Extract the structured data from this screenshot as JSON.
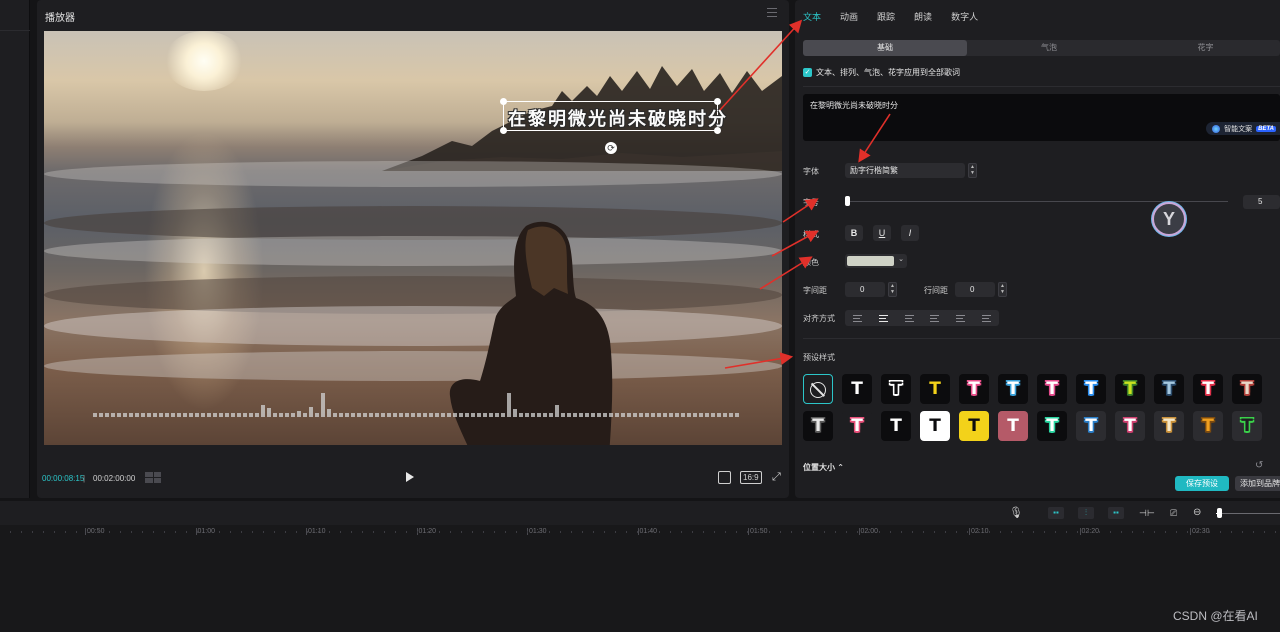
{
  "player": {
    "title": "播放器",
    "overlay_text": "在黎明微光尚未破晓时分",
    "current_time": "00:00:08:15",
    "separator": "|",
    "total_time": "00:02:00:00",
    "ratio_label": "16:9",
    "audio_levels": [
      4,
      4,
      4,
      4,
      4,
      4,
      4,
      4,
      4,
      4,
      4,
      4,
      4,
      4,
      4,
      4,
      4,
      4,
      4,
      4,
      4,
      4,
      4,
      4,
      4,
      4,
      4,
      4,
      12,
      9,
      4,
      4,
      4,
      4,
      6,
      4,
      10,
      4,
      24,
      8,
      4,
      4,
      4,
      4,
      4,
      4,
      4,
      4,
      4,
      4,
      4,
      4,
      4,
      4,
      4,
      4,
      4,
      4,
      4,
      4,
      4,
      4,
      4,
      4,
      4,
      4,
      4,
      4,
      4,
      24,
      8,
      4,
      4,
      4,
      4,
      4,
      4,
      12,
      4,
      4,
      4,
      4,
      4,
      4,
      4,
      4,
      4,
      4,
      4,
      4,
      4,
      4,
      4,
      4,
      4,
      4,
      4,
      4,
      4,
      4,
      4,
      4,
      4,
      4,
      4,
      4,
      4,
      4
    ]
  },
  "tabs": [
    {
      "label": "文本",
      "active": true
    },
    {
      "label": "动画",
      "active": false
    },
    {
      "label": "跟踪",
      "active": false
    },
    {
      "label": "朗读",
      "active": false
    },
    {
      "label": "数字人",
      "active": false
    }
  ],
  "subtabs": [
    "基础",
    "气泡",
    "花字"
  ],
  "apply_all_label": "文本、排列、气泡、花字应用到全部歌词",
  "text_content": "在黎明微光尚未破晓时分",
  "ai_button": {
    "label": "智能文案",
    "badge": "BETA"
  },
  "labels": {
    "font": "字体",
    "size": "字号",
    "style": "样式",
    "color": "颜色",
    "char_spacing": "字间距",
    "line_spacing": "行间距",
    "align": "对齐方式",
    "presets": "预设样式",
    "position_size": "位置大小"
  },
  "font_value": "励字行楷简繁",
  "size_value": "5",
  "style_buttons": [
    "B",
    "U",
    "I"
  ],
  "color_value": "#cfd2c6",
  "char_spacing_value": "0",
  "line_spacing_value": "0",
  "buttons": {
    "save_preset": "保存预设",
    "add_to_brand": "添加到品牌"
  },
  "presets": [
    {
      "glyph": "",
      "bg": "#1e1e21",
      "fg": "#e6e6e6",
      "stroke": "",
      "selected": true,
      "kind": "none"
    },
    {
      "glyph": "T",
      "bg": "#0c0c0e",
      "fg": "#ffffff",
      "stroke": ""
    },
    {
      "glyph": "T",
      "bg": "#0c0c0e",
      "fg": "#0c0c0e",
      "stroke": "#ffffff"
    },
    {
      "glyph": "T",
      "bg": "#0c0c0e",
      "fg": "#f3d21a",
      "stroke": ""
    },
    {
      "glyph": "T",
      "bg": "#0c0c0e",
      "fg": "#ffffff",
      "stroke": "#e8508a"
    },
    {
      "glyph": "T",
      "bg": "#0c0c0e",
      "fg": "#ffffff",
      "stroke": "#3aa0d8"
    },
    {
      "glyph": "T",
      "bg": "#0c0c0e",
      "fg": "#ffffff",
      "stroke": "#e44a8c"
    },
    {
      "glyph": "T",
      "bg": "#0c0c0e",
      "fg": "#ffffff",
      "stroke": "#2a8ef0"
    },
    {
      "glyph": "T",
      "bg": "#0c0c0e",
      "fg": "#c8e21f",
      "stroke": "#3a7d2a"
    },
    {
      "glyph": "T",
      "bg": "#0c0c0e",
      "fg": "#a5c8e0",
      "stroke": "#2a4a6a"
    },
    {
      "glyph": "T",
      "bg": "#0c0c0e",
      "fg": "#ffffff",
      "stroke": "#e0304a"
    },
    {
      "glyph": "T",
      "bg": "#0c0c0e",
      "fg": "#e8d8c8",
      "stroke": "#b0403a"
    },
    {
      "glyph": "T",
      "bg": "#0c0c0e",
      "fg": "#e8e8e8",
      "stroke": "#5a5a5a"
    },
    {
      "glyph": "T",
      "bg": "#1e1e21",
      "fg": "#ffffff",
      "stroke": "#e8507a"
    },
    {
      "glyph": "T",
      "bg": "#0c0c0e",
      "fg": "#ffffff",
      "stroke": ""
    },
    {
      "glyph": "T",
      "bg": "#ffffff",
      "fg": "#0c0c0e",
      "stroke": ""
    },
    {
      "glyph": "T",
      "bg": "#f3d21a",
      "fg": "#0c0c0e",
      "stroke": ""
    },
    {
      "glyph": "T",
      "bg": "#b55a68",
      "fg": "#ffffff",
      "stroke": ""
    },
    {
      "glyph": "T",
      "bg": "#0c0c0e",
      "fg": "#ffffff",
      "stroke": "#2ad4a0"
    },
    {
      "glyph": "T",
      "bg": "#2c2c30",
      "fg": "#ffffff",
      "stroke": "#2a7ec8"
    },
    {
      "glyph": "T",
      "bg": "#2c2c30",
      "fg": "#ffffff",
      "stroke": "#d04070"
    },
    {
      "glyph": "T",
      "bg": "#2c2c30",
      "fg": "#f6e8c8",
      "stroke": "#c8903a"
    },
    {
      "glyph": "T",
      "bg": "#2c2c30",
      "fg": "#f0a020",
      "stroke": "#7a4a10"
    },
    {
      "glyph": "T",
      "bg": "#2c2c30",
      "fg": "#1e1e21",
      "stroke": "#3ad04a"
    }
  ],
  "timeline": {
    "ticks": [
      "|00:50",
      "|01:00",
      "|01:10",
      "|01:20",
      "|01:30",
      "|01:40",
      "|01:50",
      "|02:00",
      "|02:10",
      "|02:20",
      "|02:30"
    ]
  },
  "watermark": "CSDN @在看AI",
  "colors": {
    "accent": "#2cc6c9",
    "arrow": "#e0302a"
  }
}
